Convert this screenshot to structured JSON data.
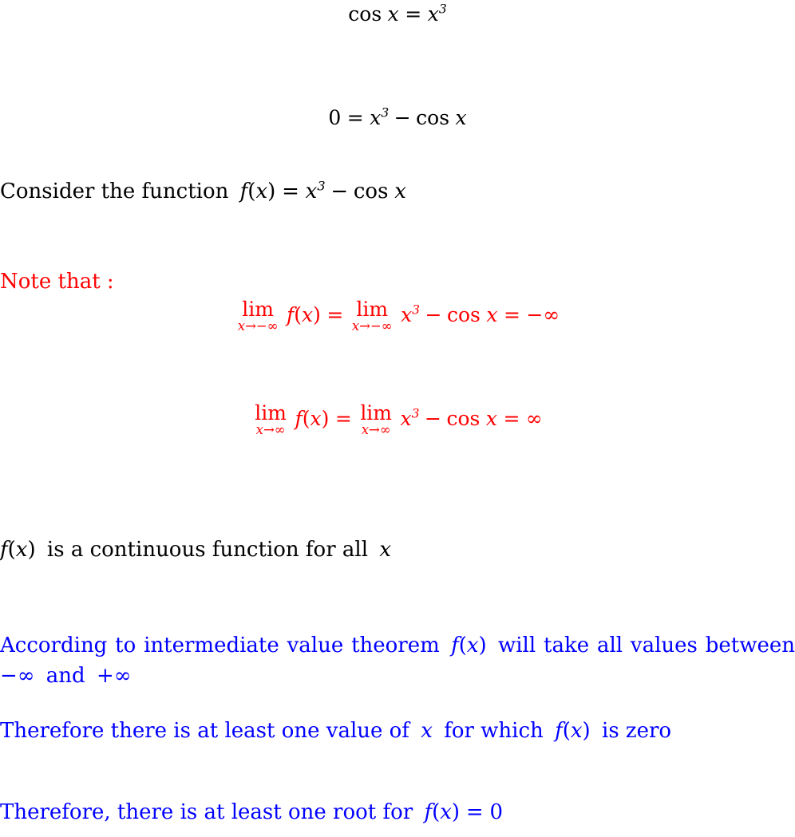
{
  "document": {
    "background_color": "#ffffff",
    "colors": {
      "statement": "#000000",
      "note": "#ff0000",
      "conclusion": "#0000ff"
    }
  },
  "equations": {
    "eq1": {
      "lhs_function": "cos",
      "lhs_var": "x",
      "relation": "=",
      "rhs_var": "x",
      "rhs_exponent": "3",
      "plain": "cos x = x^3"
    },
    "eq2": {
      "lhs": "0",
      "relation": "=",
      "rhs_var": "x",
      "rhs_exponent": "3",
      "operator": "−",
      "rhs_function": "cos",
      "rhs_function_arg": "x",
      "plain": "0 = x^3 − cos x"
    }
  },
  "consider_line": {
    "lead_text": "Consider the function",
    "f_name": "f",
    "f_arg": "x",
    "relation": "=",
    "var": "x",
    "exponent": "3",
    "operator": "−",
    "function": "cos",
    "function_arg": "x",
    "plain": "Consider the function f(x) = x^3 − cos x"
  },
  "note": {
    "heading": "Note that :",
    "limits": [
      {
        "id": "limit-neg-infinity",
        "lim_label": "lim",
        "lim_sub_var": "x",
        "lim_sub_arrow": "→",
        "lim_sub_target": "−∞",
        "f_name": "f",
        "f_arg": "x",
        "relation1": "=",
        "expr_var": "x",
        "expr_exponent": "3",
        "expr_operator": "−",
        "expr_function": "cos",
        "expr_function_arg": "x",
        "relation2": "=",
        "result": "−∞",
        "plain": "lim x→−∞ f(x) = lim x→−∞ x^3 − cos x = −∞"
      },
      {
        "id": "limit-pos-infinity",
        "lim_label": "lim",
        "lim_sub_var": "x",
        "lim_sub_arrow": "→",
        "lim_sub_target": "∞",
        "f_name": "f",
        "f_arg": "x",
        "relation1": "=",
        "expr_var": "x",
        "expr_exponent": "3",
        "expr_operator": "−",
        "expr_function": "cos",
        "expr_function_arg": "x",
        "relation2": "=",
        "result": "∞",
        "plain": "lim x→∞ f(x) = lim x→∞ x^3 − cos x = ∞"
      }
    ]
  },
  "continuity_line": {
    "f_name": "f",
    "f_arg": "x",
    "text": "is a continuous function for all",
    "var": "x",
    "plain": "f(x) is a continuous function for all x"
  },
  "conclusions": [
    {
      "id": "ivt-statement",
      "line1_part1": "According to intermediate value theorem",
      "line1_f_name": "f",
      "line1_f_arg": "x",
      "line1_part2": "will take all values between",
      "line2_neg": "−∞",
      "line2_and": "and",
      "line2_pos": "+∞",
      "plain": "According to intermediate value theorem f(x) will take all values between −∞ and +∞"
    },
    {
      "id": "exists-zero-statement",
      "part1": "Therefore there is at least one value of",
      "var": "x",
      "part2": "for which",
      "f_name": "f",
      "f_arg": "x",
      "part3": "is zero",
      "plain": "Therefore there is at least one value of x for which f(x) is zero"
    },
    {
      "id": "root-statement",
      "part1": "Therefore, there is at least one root for",
      "f_name": "f",
      "f_arg": "x",
      "relation": "=",
      "value": "0",
      "plain": "Therefore, there is at least one root for f(x) = 0"
    }
  ]
}
